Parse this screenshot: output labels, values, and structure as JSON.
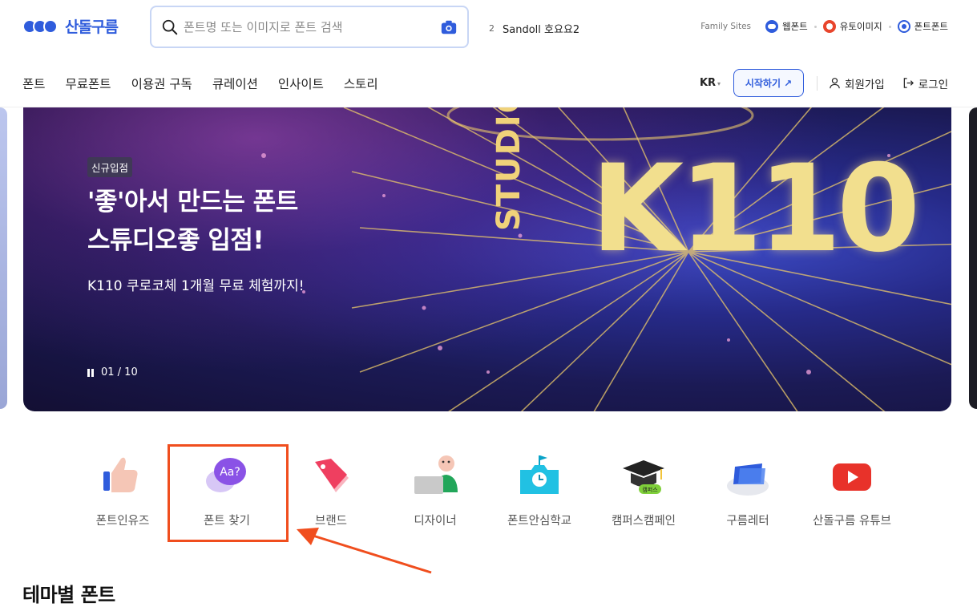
{
  "logo": {
    "text": "산돌구름"
  },
  "search": {
    "placeholder": "폰트명 또는 이미지로 폰트 검색"
  },
  "trending": {
    "rank": "2",
    "text": "Sandoll 호요요2"
  },
  "family_sites": {
    "label": "Family Sites",
    "items": [
      {
        "label": "웹폰트",
        "icon": "webfont-icon",
        "color": "#2f5cdc"
      },
      {
        "label": "유토이미지",
        "icon": "utoimage-icon",
        "color": "#e8452c"
      },
      {
        "label": "폰트폰트",
        "icon": "fontfont-icon",
        "color": "#2f5cdc"
      }
    ]
  },
  "nav": {
    "items": [
      "폰트",
      "무료폰트",
      "이용권 구독",
      "큐레이션",
      "인사이트",
      "스토리"
    ],
    "lang": "KR",
    "start_label": "시작하기 ↗",
    "signup_label": "회원가입",
    "login_label": "로그인"
  },
  "banner": {
    "badge": "신규입점",
    "title_line1": "'좋'아서 만드는 폰트",
    "title_line2": "스튜디오좋 입점!",
    "subtitle": "K110 쿠로코체 1개월 무료 체험까지!",
    "pager": "01 / 10",
    "art_word1": "STUDIO",
    "art_word2": "K110"
  },
  "quick_menu": [
    {
      "label": "폰트인유즈",
      "icon": "thumbs-up-icon"
    },
    {
      "label": "폰트 찾기",
      "icon": "font-search-icon",
      "icon_text": "Aa?"
    },
    {
      "label": "브랜드",
      "icon": "tag-icon"
    },
    {
      "label": "디자이너",
      "icon": "designer-icon"
    },
    {
      "label": "폰트안심학교",
      "icon": "school-icon"
    },
    {
      "label": "캠퍼스캠페인",
      "icon": "graduation-cap-icon",
      "icon_text": "캠퍼스"
    },
    {
      "label": "구름레터",
      "icon": "letter-icon"
    },
    {
      "label": "산돌구름 유튜브",
      "icon": "youtube-icon"
    }
  ],
  "section": {
    "title": "테마별 폰트"
  },
  "colors": {
    "brand": "#2f5cdc",
    "highlight": "#f04e1e"
  }
}
